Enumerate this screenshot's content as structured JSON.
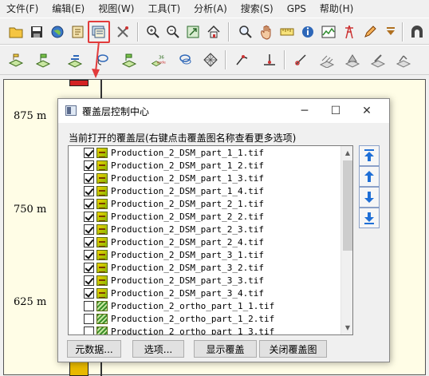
{
  "menu": [
    "文件(F)",
    "编辑(E)",
    "视图(W)",
    "工具(T)",
    "分析(A)",
    "搜索(S)",
    "GPS",
    "帮助(H)"
  ],
  "axis_labels": [
    "875 m",
    "750 m",
    "625 m"
  ],
  "dialog": {
    "title": "覆盖层控制中心",
    "caption": "当前打开的覆盖层(右键点击覆盖图名称查看更多选项)",
    "layers": [
      {
        "name": "Production_2_DSM_part_1_1.tif",
        "checked": true,
        "type": "dsm"
      },
      {
        "name": "Production_2_DSM_part_1_2.tif",
        "checked": true,
        "type": "dsm"
      },
      {
        "name": "Production_2_DSM_part_1_3.tif",
        "checked": true,
        "type": "dsm"
      },
      {
        "name": "Production_2_DSM_part_1_4.tif",
        "checked": true,
        "type": "dsm"
      },
      {
        "name": "Production_2_DSM_part_2_1.tif",
        "checked": true,
        "type": "dsm"
      },
      {
        "name": "Production_2_DSM_part_2_2.tif",
        "checked": true,
        "type": "dsm"
      },
      {
        "name": "Production_2_DSM_part_2_3.tif",
        "checked": true,
        "type": "dsm"
      },
      {
        "name": "Production_2_DSM_part_2_4.tif",
        "checked": true,
        "type": "dsm"
      },
      {
        "name": "Production_2_DSM_part_3_1.tif",
        "checked": true,
        "type": "dsm"
      },
      {
        "name": "Production_2_DSM_part_3_2.tif",
        "checked": true,
        "type": "dsm"
      },
      {
        "name": "Production_2_DSM_part_3_3.tif",
        "checked": true,
        "type": "dsm"
      },
      {
        "name": "Production_2_DSM_part_3_4.tif",
        "checked": true,
        "type": "dsm"
      },
      {
        "name": "Production_2_ortho_part_1_1.tif",
        "checked": false,
        "type": "ortho"
      },
      {
        "name": "Production_2_ortho_part_1_2.tif",
        "checked": false,
        "type": "ortho"
      },
      {
        "name": "Production_2_ortho_part_1_3.tif",
        "checked": false,
        "type": "ortho"
      }
    ],
    "buttons": {
      "metadata": "元数据...",
      "options": "选项...",
      "show": "显示覆盖",
      "close_overlay": "关闭覆盖图"
    }
  },
  "toolbar1_icons": [
    "folder-open-icon",
    "save-icon",
    "globe-icon",
    "map-catalog-icon",
    "overlay-control-center-icon",
    "tools-icon",
    "zoom-in-icon",
    "zoom-out-icon",
    "zoom-to-layer-icon",
    "home-icon",
    "magnify-icon",
    "pan-hand-icon",
    "measure-icon",
    "info-icon",
    "profile-icon",
    "tower-icon",
    "draw-icon",
    "dropdown-icon",
    "tunnel-icon"
  ],
  "toolbar2_icons": [
    "layer-edit-icon",
    "layer-flag-icon",
    "layer-level-icon",
    "layer-lasso-icon",
    "layer-arrow-icon",
    "code-36-icon",
    "lasso-multi-icon",
    "grid-icon",
    "point-move-icon",
    "point-tool-icon",
    "cut-icon",
    "hatch-icon",
    "area-icon",
    "pen-icon",
    "roads-icon"
  ],
  "colors": {
    "highlight": "#e23b3b",
    "map_bg": "#fffde6",
    "strip_yellow": "#e8b900",
    "strip_red": "#d32222",
    "move_btn_blue": "#1f6fd6"
  }
}
